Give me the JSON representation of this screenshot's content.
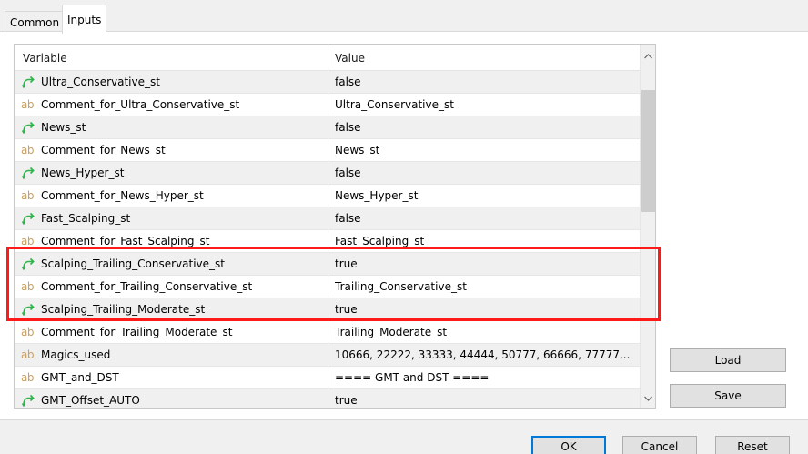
{
  "tabs": {
    "common": "Common",
    "inputs": "Inputs"
  },
  "grid": {
    "col_variable": "Variable",
    "col_value": "Value",
    "rows": [
      {
        "type": "bool",
        "icon": "green-arrow-icon",
        "variable": "Ultra_Conservative_st",
        "value": "false"
      },
      {
        "type": "str",
        "icon": "ab-string-icon",
        "variable": "Comment_for_Ultra_Conservative_st",
        "value": "Ultra_Conservative_st"
      },
      {
        "type": "bool",
        "icon": "green-arrow-icon",
        "variable": "News_st",
        "value": "false"
      },
      {
        "type": "str",
        "icon": "ab-string-icon",
        "variable": "Comment_for_News_st",
        "value": "News_st"
      },
      {
        "type": "bool",
        "icon": "green-arrow-icon",
        "variable": "News_Hyper_st",
        "value": "false"
      },
      {
        "type": "str",
        "icon": "ab-string-icon",
        "variable": "Comment_for_News_Hyper_st",
        "value": "News_Hyper_st"
      },
      {
        "type": "bool",
        "icon": "green-arrow-icon",
        "variable": "Fast_Scalping_st",
        "value": "false"
      },
      {
        "type": "str",
        "icon": "ab-string-icon",
        "variable": "Comment_for_Fast_Scalping_st",
        "value": "Fast_Scalping_st"
      },
      {
        "type": "bool",
        "icon": "green-arrow-icon",
        "variable": "Scalping_Trailing_Conservative_st",
        "value": "true"
      },
      {
        "type": "str",
        "icon": "ab-string-icon",
        "variable": "Comment_for_Trailing_Conservative_st",
        "value": "Trailing_Conservative_st"
      },
      {
        "type": "bool",
        "icon": "green-arrow-icon",
        "variable": "Scalping_Trailing_Moderate_st",
        "value": "true"
      },
      {
        "type": "str",
        "icon": "ab-string-icon",
        "variable": "Comment_for_Trailing_Moderate_st",
        "value": "Trailing_Moderate_st"
      },
      {
        "type": "str",
        "icon": "ab-string-icon",
        "variable": "Magics_used",
        "value": "10666, 22222, 33333, 44444, 50777, 66666, 77777..."
      },
      {
        "type": "str",
        "icon": "ab-string-icon",
        "variable": "GMT_and_DST",
        "value": "==== GMT and DST ===="
      },
      {
        "type": "bool",
        "icon": "green-arrow-icon",
        "variable": "GMT_Offset_AUTO",
        "value": "true"
      }
    ]
  },
  "buttons": {
    "load": "Load",
    "save": "Save",
    "ok": "OK",
    "cancel": "Cancel",
    "reset": "Reset"
  },
  "colors": {
    "highlight": "#ff1a1a",
    "bool_icon": "#2db34a",
    "string_icon": "#c8a060"
  }
}
